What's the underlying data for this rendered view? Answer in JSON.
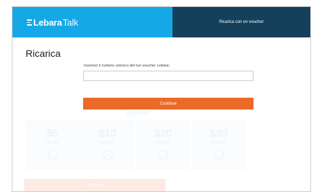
{
  "header": {
    "brand": "Lebara",
    "brand_suffix": "Talk",
    "nav_link": "Ricarica con un voucher",
    "colors": {
      "brand_bg": "#16a7e6",
      "nav_bg": "#14405c"
    }
  },
  "page": {
    "title": "Ricarica",
    "voucher_label": "Inserisci il numero univoco del tuo voucher Lebara:",
    "voucher_value": "",
    "continue_label": "Continue"
  },
  "faded_section": {
    "title": "Importo",
    "cards": [
      {
        "amount": "$5",
        "unit": "Credito"
      },
      {
        "amount": "$10",
        "unit": "Credito"
      },
      {
        "amount": "$20",
        "unit": "Credito"
      },
      {
        "amount": "$30",
        "unit": "Credito"
      }
    ],
    "bottom_button": "Continua",
    "accent": "#ea6a26"
  }
}
